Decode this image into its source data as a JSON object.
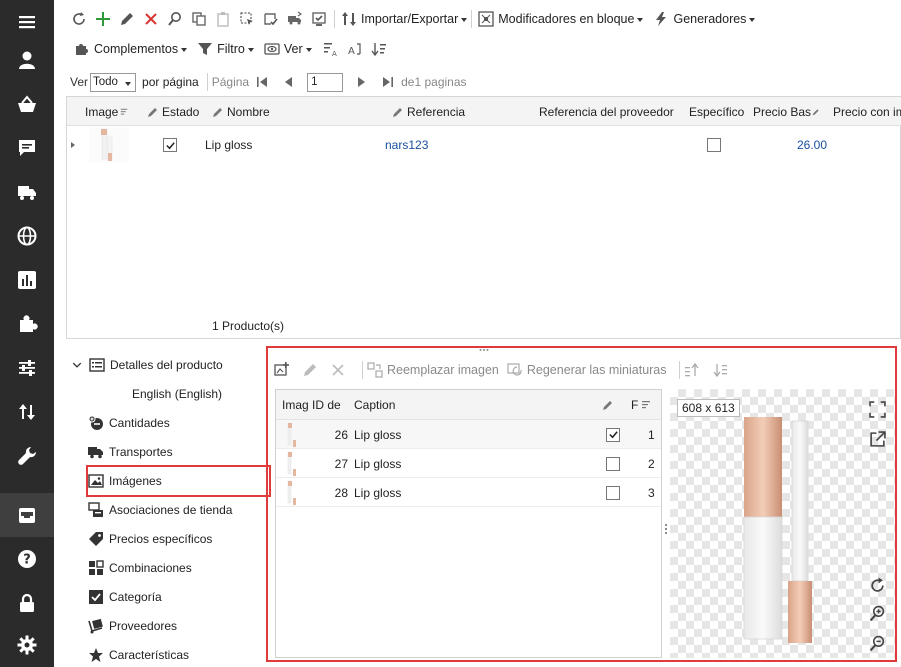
{
  "sidebar": {
    "items": [
      {
        "icon": "menu-icon"
      },
      {
        "icon": "user-icon"
      },
      {
        "icon": "basket-icon"
      },
      {
        "icon": "chat-icon"
      },
      {
        "icon": "truck-icon"
      },
      {
        "icon": "globe-icon"
      },
      {
        "icon": "chart-icon"
      },
      {
        "icon": "puzzle-icon"
      },
      {
        "icon": "sliders-icon"
      },
      {
        "icon": "sort-arrows-icon"
      },
      {
        "icon": "wrench-icon"
      },
      {
        "icon": "inbox-icon"
      },
      {
        "icon": "help-icon"
      },
      {
        "icon": "lock-icon"
      },
      {
        "icon": "gear-icon"
      }
    ]
  },
  "toolbar1": {
    "import_export": "Importar/Exportar",
    "bulk_modifiers": "Modificadores en bloque",
    "generators": "Generadores"
  },
  "toolbar2": {
    "addons": "Complementos",
    "filter": "Filtro",
    "view": "Ver"
  },
  "pager": {
    "show_label": "Ver",
    "per_page_value": "Todo",
    "per_page_label": "por página",
    "page_label": "Página",
    "page_value": "1",
    "of_pages": "de1 paginas"
  },
  "grid": {
    "columns": [
      "Image",
      "Estado",
      "Nombre",
      "Referencia",
      "Referencia del proveedor",
      "Específico",
      "Precio Bas",
      "Precio con im"
    ],
    "row": {
      "nombre": "Lip gloss",
      "referencia": "nars123",
      "precio": "26.00"
    },
    "footer": "1 Producto(s)"
  },
  "tree": {
    "items": [
      {
        "label": "Detalles del producto",
        "icon": "list-icon"
      },
      {
        "label": "English (English)",
        "icon": ""
      },
      {
        "label": "Cantidades",
        "icon": "quantity-icon"
      },
      {
        "label": "Transportes",
        "icon": "truck-icon"
      },
      {
        "label": "Imágenes",
        "icon": "image-icon"
      },
      {
        "label": "Asociaciones de tienda",
        "icon": "store-icon"
      },
      {
        "label": "Precios específicos",
        "icon": "tag-icon"
      },
      {
        "label": "Combinaciones",
        "icon": "grid-icon"
      },
      {
        "label": "Categoría",
        "icon": "checkbox-icon"
      },
      {
        "label": "Proveedores",
        "icon": "dolly-icon"
      },
      {
        "label": "Características",
        "icon": "star-icon"
      }
    ]
  },
  "image_panel": {
    "replace_label": "Reemplazar imagen",
    "regen_label": "Regenerar las miniaturas",
    "columns": [
      "Imag",
      "ID de",
      "Caption",
      "F"
    ],
    "rows": [
      {
        "id": "26",
        "caption": "Lip gloss",
        "checked": true,
        "pos": "1"
      },
      {
        "id": "27",
        "caption": "Lip gloss",
        "checked": false,
        "pos": "2"
      },
      {
        "id": "28",
        "caption": "Lip gloss",
        "checked": false,
        "pos": "3"
      }
    ],
    "preview_size": "608 x 613"
  },
  "colors": {
    "sidebar": "#2b2b2b",
    "highlight": "#e03a3a",
    "link_blue": "#1a4fa0",
    "add_green": "#2e9b3a",
    "delete_red": "#d83434"
  }
}
